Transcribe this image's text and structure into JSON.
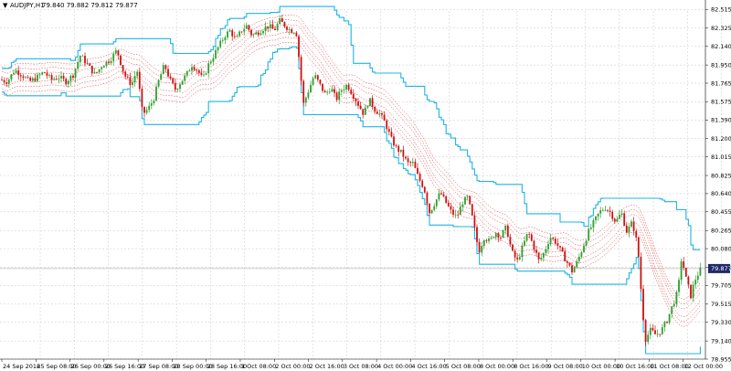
{
  "header": {
    "arrow": "▼",
    "symbol": "AUDJPY,H1",
    "quote": "79.840 79.882 79.812 79.877"
  },
  "price_marker": "79.877",
  "colors": {
    "bull": "#2e9e2e",
    "bear": "#d01010",
    "channel": "#1fb4e6",
    "bands": "#e03030",
    "grid": "#c8c8c8",
    "marker_bg": "#1e2a6a"
  },
  "chart_data": {
    "type": "candlestick",
    "title": "AUDJPY,H1",
    "ylim": [
      78.955,
      82.5
    ],
    "grid": true,
    "y_ticks": [
      "82.515",
      "82.325",
      "82.140",
      "81.950",
      "81.765",
      "81.575",
      "81.390",
      "81.200",
      "81.015",
      "80.825",
      "80.640",
      "80.455",
      "80.265",
      "80.080",
      "79.890",
      "79.705",
      "79.515",
      "79.330",
      "79.140",
      "78.955"
    ],
    "x_labels": [
      "24 Sep 2018",
      "25 Sep 08:00",
      "26 Sep 00:00",
      "26 Sep 16:00",
      "27 Sep 08:00",
      "28 Sep 00:00",
      "28 Sep 16:00",
      "1 Oct 08:00",
      "2 Oct 00:00",
      "2 Oct 16:00",
      "3 Oct 08:00",
      "4 Oct 00:00",
      "4 Oct 16:00",
      "5 Oct 08:00",
      "8 Oct 00:00",
      "8 Oct 16:00",
      "9 Oct 08:00",
      "10 Oct 00:00",
      "10 Oct 16:00",
      "11 Oct 08:00",
      "12 Oct 00:00"
    ],
    "price_path": [
      [
        0,
        81.8
      ],
      [
        8,
        81.78
      ],
      [
        16,
        81.9
      ],
      [
        24,
        81.85
      ],
      [
        32,
        81.78
      ],
      [
        40,
        81.82
      ],
      [
        48,
        81.88
      ],
      [
        56,
        81.8
      ],
      [
        64,
        81.83
      ],
      [
        72,
        81.78
      ],
      [
        80,
        81.85
      ],
      [
        88,
        82.05
      ],
      [
        96,
        81.95
      ],
      [
        104,
        81.85
      ],
      [
        112,
        81.95
      ],
      [
        120,
        82.0
      ],
      [
        128,
        82.1
      ],
      [
        136,
        81.85
      ],
      [
        144,
        81.75
      ],
      [
        150,
        81.9
      ],
      [
        156,
        81.45
      ],
      [
        162,
        81.5
      ],
      [
        168,
        81.6
      ],
      [
        174,
        81.8
      ],
      [
        180,
        81.95
      ],
      [
        186,
        81.8
      ],
      [
        192,
        81.7
      ],
      [
        198,
        81.78
      ],
      [
        204,
        81.85
      ],
      [
        210,
        81.95
      ],
      [
        216,
        81.9
      ],
      [
        222,
        81.8
      ],
      [
        228,
        81.95
      ],
      [
        234,
        82.05
      ],
      [
        240,
        82.15
      ],
      [
        246,
        82.25
      ],
      [
        252,
        82.3
      ],
      [
        258,
        82.2
      ],
      [
        264,
        82.3
      ],
      [
        270,
        82.35
      ],
      [
        276,
        82.25
      ],
      [
        282,
        82.28
      ],
      [
        288,
        82.32
      ],
      [
        294,
        82.35
      ],
      [
        300,
        82.3
      ],
      [
        306,
        82.4
      ],
      [
        312,
        82.35
      ],
      [
        318,
        82.3
      ],
      [
        324,
        82.3
      ],
      [
        328,
        81.95
      ],
      [
        332,
        81.55
      ],
      [
        338,
        81.7
      ],
      [
        344,
        81.85
      ],
      [
        350,
        81.75
      ],
      [
        356,
        81.65
      ],
      [
        362,
        81.72
      ],
      [
        368,
        81.6
      ],
      [
        374,
        81.7
      ],
      [
        380,
        81.75
      ],
      [
        386,
        81.65
      ],
      [
        392,
        81.55
      ],
      [
        398,
        81.45
      ],
      [
        404,
        81.6
      ],
      [
        410,
        81.5
      ],
      [
        416,
        81.45
      ],
      [
        422,
        81.35
      ],
      [
        428,
        81.2
      ],
      [
        434,
        81.1
      ],
      [
        440,
        81.05
      ],
      [
        446,
        80.95
      ],
      [
        452,
        80.95
      ],
      [
        458,
        80.8
      ],
      [
        464,
        80.7
      ],
      [
        470,
        80.45
      ],
      [
        476,
        80.55
      ],
      [
        482,
        80.65
      ],
      [
        488,
        80.55
      ],
      [
        494,
        80.45
      ],
      [
        500,
        80.4
      ],
      [
        506,
        80.55
      ],
      [
        512,
        80.6
      ],
      [
        518,
        80.35
      ],
      [
        524,
        80.05
      ],
      [
        530,
        80.2
      ],
      [
        536,
        80.15
      ],
      [
        542,
        80.25
      ],
      [
        548,
        80.2
      ],
      [
        554,
        80.3
      ],
      [
        560,
        80.05
      ],
      [
        566,
        79.95
      ],
      [
        572,
        80.1
      ],
      [
        578,
        80.25
      ],
      [
        584,
        80.1
      ],
      [
        590,
        79.95
      ],
      [
        596,
        80.05
      ],
      [
        602,
        80.2
      ],
      [
        608,
        80.15
      ],
      [
        614,
        80.05
      ],
      [
        620,
        79.95
      ],
      [
        626,
        79.85
      ],
      [
        632,
        79.95
      ],
      [
        638,
        80.1
      ],
      [
        644,
        80.25
      ],
      [
        650,
        80.35
      ],
      [
        656,
        80.45
      ],
      [
        662,
        80.5
      ],
      [
        668,
        80.45
      ],
      [
        674,
        80.35
      ],
      [
        680,
        80.45
      ],
      [
        686,
        80.25
      ],
      [
        692,
        80.35
      ],
      [
        698,
        80.1
      ],
      [
        702,
        79.6
      ],
      [
        706,
        79.15
      ],
      [
        712,
        79.25
      ],
      [
        718,
        79.2
      ],
      [
        724,
        79.25
      ],
      [
        730,
        79.35
      ],
      [
        736,
        79.5
      ],
      [
        742,
        79.65
      ],
      [
        746,
        80.0
      ],
      [
        750,
        79.8
      ],
      [
        756,
        79.6
      ],
      [
        760,
        79.75
      ],
      [
        766,
        79.86
      ],
      [
        770,
        79.877
      ]
    ]
  }
}
